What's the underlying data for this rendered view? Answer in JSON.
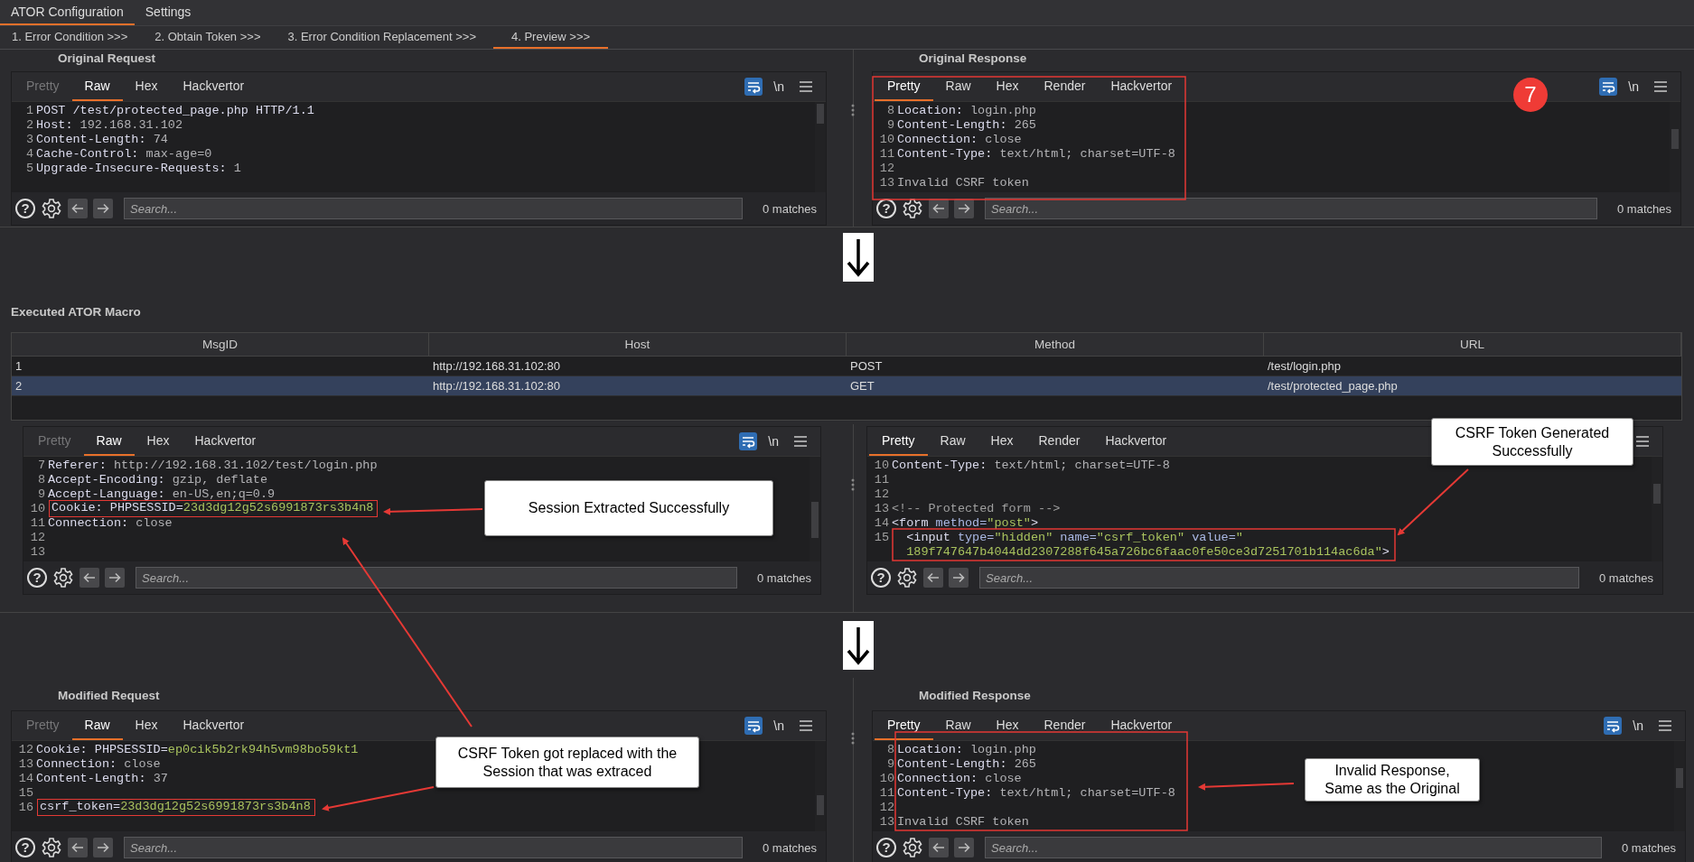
{
  "top_tabs": [
    {
      "label": "ATOR Configuration",
      "selected": true
    },
    {
      "label": "Settings",
      "selected": false
    }
  ],
  "step_tabs": [
    {
      "label": "1. Error Condition >>>",
      "selected": false
    },
    {
      "label": "2. Obtain Token >>>",
      "selected": false
    },
    {
      "label": "3. Error Condition Replacement >>>",
      "selected": false
    },
    {
      "label": "4. Preview >>>",
      "selected": true
    }
  ],
  "original": {
    "request": {
      "title": "Original Request",
      "editor": {
        "tabs": [
          {
            "label": "Pretty",
            "selected": false,
            "disabled": true
          },
          {
            "label": "Raw",
            "selected": true,
            "disabled": false
          },
          {
            "label": "Hex",
            "selected": false,
            "disabled": false
          },
          {
            "label": "Hackvertor",
            "selected": false,
            "disabled": false
          }
        ],
        "newline": "\\n",
        "lines": [
          {
            "n": "1",
            "parts": [
              {
                "text": "POST /test/protected_page.php HTTP/1.1",
                "kind": "key"
              }
            ]
          },
          {
            "n": "2",
            "parts": [
              {
                "text": "Host: ",
                "kind": "key"
              },
              {
                "text": "192.168.31.102",
                "kind": "value"
              }
            ]
          },
          {
            "n": "3",
            "parts": [
              {
                "text": "Content-Length: ",
                "kind": "key"
              },
              {
                "text": "74",
                "kind": "value"
              }
            ]
          },
          {
            "n": "4",
            "parts": [
              {
                "text": "Cache-Control: ",
                "kind": "key"
              },
              {
                "text": "max-age=0",
                "kind": "value"
              }
            ]
          },
          {
            "n": "5",
            "parts": [
              {
                "text": "Upgrade-Insecure-Requests: ",
                "kind": "key"
              },
              {
                "text": "1",
                "kind": "value"
              }
            ]
          }
        ],
        "help": "?",
        "placeholder": "Search...",
        "matches": "0 matches"
      }
    },
    "response": {
      "title": "Original Response",
      "editor": {
        "tabs": [
          {
            "label": "Pretty",
            "selected": true,
            "disabled": false
          },
          {
            "label": "Raw",
            "selected": false,
            "disabled": false
          },
          {
            "label": "Hex",
            "selected": false,
            "disabled": false
          },
          {
            "label": "Render",
            "selected": false,
            "disabled": false
          },
          {
            "label": "Hackvertor",
            "selected": false,
            "disabled": false
          }
        ],
        "newline": "\\n",
        "lines": [
          {
            "n": "8",
            "parts": [
              {
                "text": "Location: ",
                "kind": "key"
              },
              {
                "text": "login.php",
                "kind": "value"
              }
            ]
          },
          {
            "n": "9",
            "parts": [
              {
                "text": "Content-Length: ",
                "kind": "key"
              },
              {
                "text": "265",
                "kind": "value"
              }
            ]
          },
          {
            "n": "10",
            "parts": [
              {
                "text": "Connection: ",
                "kind": "key"
              },
              {
                "text": "close",
                "kind": "value"
              }
            ]
          },
          {
            "n": "11",
            "parts": [
              {
                "text": "Content-Type: ",
                "kind": "key"
              },
              {
                "text": "text/html; charset=UTF-8",
                "kind": "value"
              }
            ]
          },
          {
            "n": "12"
          },
          {
            "n": "13",
            "parts": [
              {
                "text": "Invalid CSRF token",
                "kind": "value"
              }
            ]
          }
        ],
        "help": "?",
        "placeholder": "Search...",
        "matches": "0 matches"
      }
    }
  },
  "macro": {
    "title": "Executed ATOR Macro",
    "columns": [
      "MsgID",
      "Host",
      "Method",
      "URL"
    ],
    "rows": [
      {
        "cells": [
          "1",
          "http://192.168.31.102:80",
          "POST",
          "/test/login.php"
        ],
        "selected": false
      },
      {
        "cells": [
          "2",
          "http://192.168.31.102:80",
          "GET",
          "/test/protected_page.php"
        ],
        "selected": true
      }
    ],
    "request": {
      "editor": {
        "tabs": [
          {
            "label": "Pretty",
            "selected": false,
            "disabled": true
          },
          {
            "label": "Raw",
            "selected": true,
            "disabled": false
          },
          {
            "label": "Hex",
            "selected": false,
            "disabled": false
          },
          {
            "label": "Hackvertor",
            "selected": false,
            "disabled": false
          }
        ],
        "newline": "\\n",
        "lines": [
          {
            "n": "7",
            "parts": [
              {
                "text": "Referer: ",
                "kind": "key"
              },
              {
                "text": "http://192.168.31.102/test/login.php",
                "kind": "value"
              }
            ]
          },
          {
            "n": "8",
            "parts": [
              {
                "text": "Accept-Encoding: ",
                "kind": "key"
              },
              {
                "text": "gzip, deflate",
                "kind": "value"
              }
            ]
          },
          {
            "n": "9",
            "parts": [
              {
                "text": "Accept-Language: ",
                "kind": "key"
              },
              {
                "text": "en-US,en;q=0.9",
                "kind": "value"
              }
            ]
          },
          {
            "n": "10",
            "parts": [
              {
                "text": "Cookie: PHPSESSID=",
                "kind": "key"
              },
              {
                "text": "23d3dg12g52s6991873rs3b4n8",
                "kind": "string"
              }
            ],
            "highlighted": true
          },
          {
            "n": "11",
            "parts": [
              {
                "text": "Connection: ",
                "kind": "key"
              },
              {
                "text": "close",
                "kind": "value"
              }
            ]
          },
          {
            "n": "12"
          },
          {
            "n": "13"
          }
        ],
        "help": "?",
        "placeholder": "Search...",
        "matches": "0 matches"
      }
    },
    "response": {
      "editor": {
        "tabs": [
          {
            "label": "Pretty",
            "selected": true,
            "disabled": false
          },
          {
            "label": "Raw",
            "selected": false,
            "disabled": false
          },
          {
            "label": "Hex",
            "selected": false,
            "disabled": false
          },
          {
            "label": "Render",
            "selected": false,
            "disabled": false
          },
          {
            "label": "Hackvertor",
            "selected": false,
            "disabled": false
          }
        ],
        "lines": [
          {
            "n": "10",
            "parts": [
              {
                "text": "Content-Type: ",
                "kind": "key"
              },
              {
                "text": "text/html; charset=UTF-8",
                "kind": "value"
              }
            ]
          },
          {
            "n": "11"
          },
          {
            "n": "12"
          },
          {
            "n": "13",
            "parts": [
              {
                "text": "<!-- Protected form -->",
                "kind": "comment"
              }
            ]
          },
          {
            "n": "14",
            "parts": [
              {
                "text": "<form",
                "kind": "key"
              },
              {
                "text": " method=",
                "kind": "attr"
              },
              {
                "text": "\"post\"",
                "kind": "string"
              },
              {
                "text": ">",
                "kind": "key"
              }
            ]
          },
          {
            "n": "15",
            "parts": [
              {
                "text": "  <input",
                "kind": "key"
              },
              {
                "text": " type=",
                "kind": "attr"
              },
              {
                "text": "\"hidden\"",
                "kind": "string"
              },
              {
                "text": " name=",
                "kind": "attr"
              },
              {
                "text": "\"csrf_token\"",
                "kind": "string"
              },
              {
                "text": " value=",
                "kind": "attr"
              },
              {
                "text": "\"",
                "kind": "string"
              }
            ]
          },
          {
            "parts": [
              {
                "text": "  189f747647b4044dd2307288f645a726bc6faac0fe50ce3d7251701b114ac6da\"",
                "kind": "string"
              },
              {
                "text": ">",
                "kind": "key"
              }
            ]
          }
        ],
        "help": "?",
        "placeholder": "Search...",
        "matches": "0 matches"
      }
    }
  },
  "modified": {
    "request": {
      "title": "Modified Request",
      "editor": {
        "tabs": [
          {
            "label": "Pretty",
            "selected": false,
            "disabled": true
          },
          {
            "label": "Raw",
            "selected": true,
            "disabled": false
          },
          {
            "label": "Hex",
            "selected": false,
            "disabled": false
          },
          {
            "label": "Hackvertor",
            "selected": false,
            "disabled": false
          }
        ],
        "newline": "\\n",
        "lines": [
          {
            "n": "12",
            "parts": [
              {
                "text": "Cookie: PHPSESSID=",
                "kind": "key"
              },
              {
                "text": "ep0cik5b2rk94h5vm98bo59kt1",
                "kind": "string"
              }
            ]
          },
          {
            "n": "13",
            "parts": [
              {
                "text": "Connection: ",
                "kind": "key"
              },
              {
                "text": "close",
                "kind": "value"
              }
            ]
          },
          {
            "n": "14",
            "parts": [
              {
                "text": "Content-Length: ",
                "kind": "key"
              },
              {
                "text": "37",
                "kind": "value"
              }
            ]
          },
          {
            "n": "15"
          },
          {
            "n": "16",
            "parts": [
              {
                "text": "csrf_token=",
                "kind": "key"
              },
              {
                "text": "23d3dg12g52s6991873rs3b4n8",
                "kind": "string"
              }
            ],
            "highlighted": true
          }
        ],
        "help": "?",
        "placeholder": "Search...",
        "matches": "0 matches"
      }
    },
    "response": {
      "title": "Modified Response",
      "editor": {
        "tabs": [
          {
            "label": "Pretty",
            "selected": true,
            "disabled": false
          },
          {
            "label": "Raw",
            "selected": false,
            "disabled": false
          },
          {
            "label": "Hex",
            "selected": false,
            "disabled": false
          },
          {
            "label": "Render",
            "selected": false,
            "disabled": false
          },
          {
            "label": "Hackvertor",
            "selected": false,
            "disabled": false
          }
        ],
        "newline": "\\n",
        "lines": [
          {
            "n": "8",
            "parts": [
              {
                "text": "Location: ",
                "kind": "key"
              },
              {
                "text": "login.php",
                "kind": "value"
              }
            ]
          },
          {
            "n": "9",
            "parts": [
              {
                "text": "Content-Length: ",
                "kind": "key"
              },
              {
                "text": "265",
                "kind": "value"
              }
            ]
          },
          {
            "n": "10",
            "parts": [
              {
                "text": "Connection: ",
                "kind": "key"
              },
              {
                "text": "close",
                "kind": "value"
              }
            ]
          },
          {
            "n": "11",
            "parts": [
              {
                "text": "Content-Type: ",
                "kind": "key"
              },
              {
                "text": "text/html; charset=UTF-8",
                "kind": "value"
              }
            ]
          },
          {
            "n": "12"
          },
          {
            "n": "13",
            "parts": [
              {
                "text": "Invalid CSRF token",
                "kind": "value"
              }
            ]
          }
        ],
        "help": "?",
        "placeholder": "Search...",
        "matches": "0 matches"
      }
    }
  },
  "callouts": [
    {
      "text": "Session Extracted Successfully"
    },
    {
      "text": "CSRF Token Generated Successfully"
    },
    {
      "text": "CSRF Token got replaced with the Session that was extraced"
    },
    {
      "text": "Invalid Response, Same as the Original"
    }
  ],
  "badge": "7"
}
